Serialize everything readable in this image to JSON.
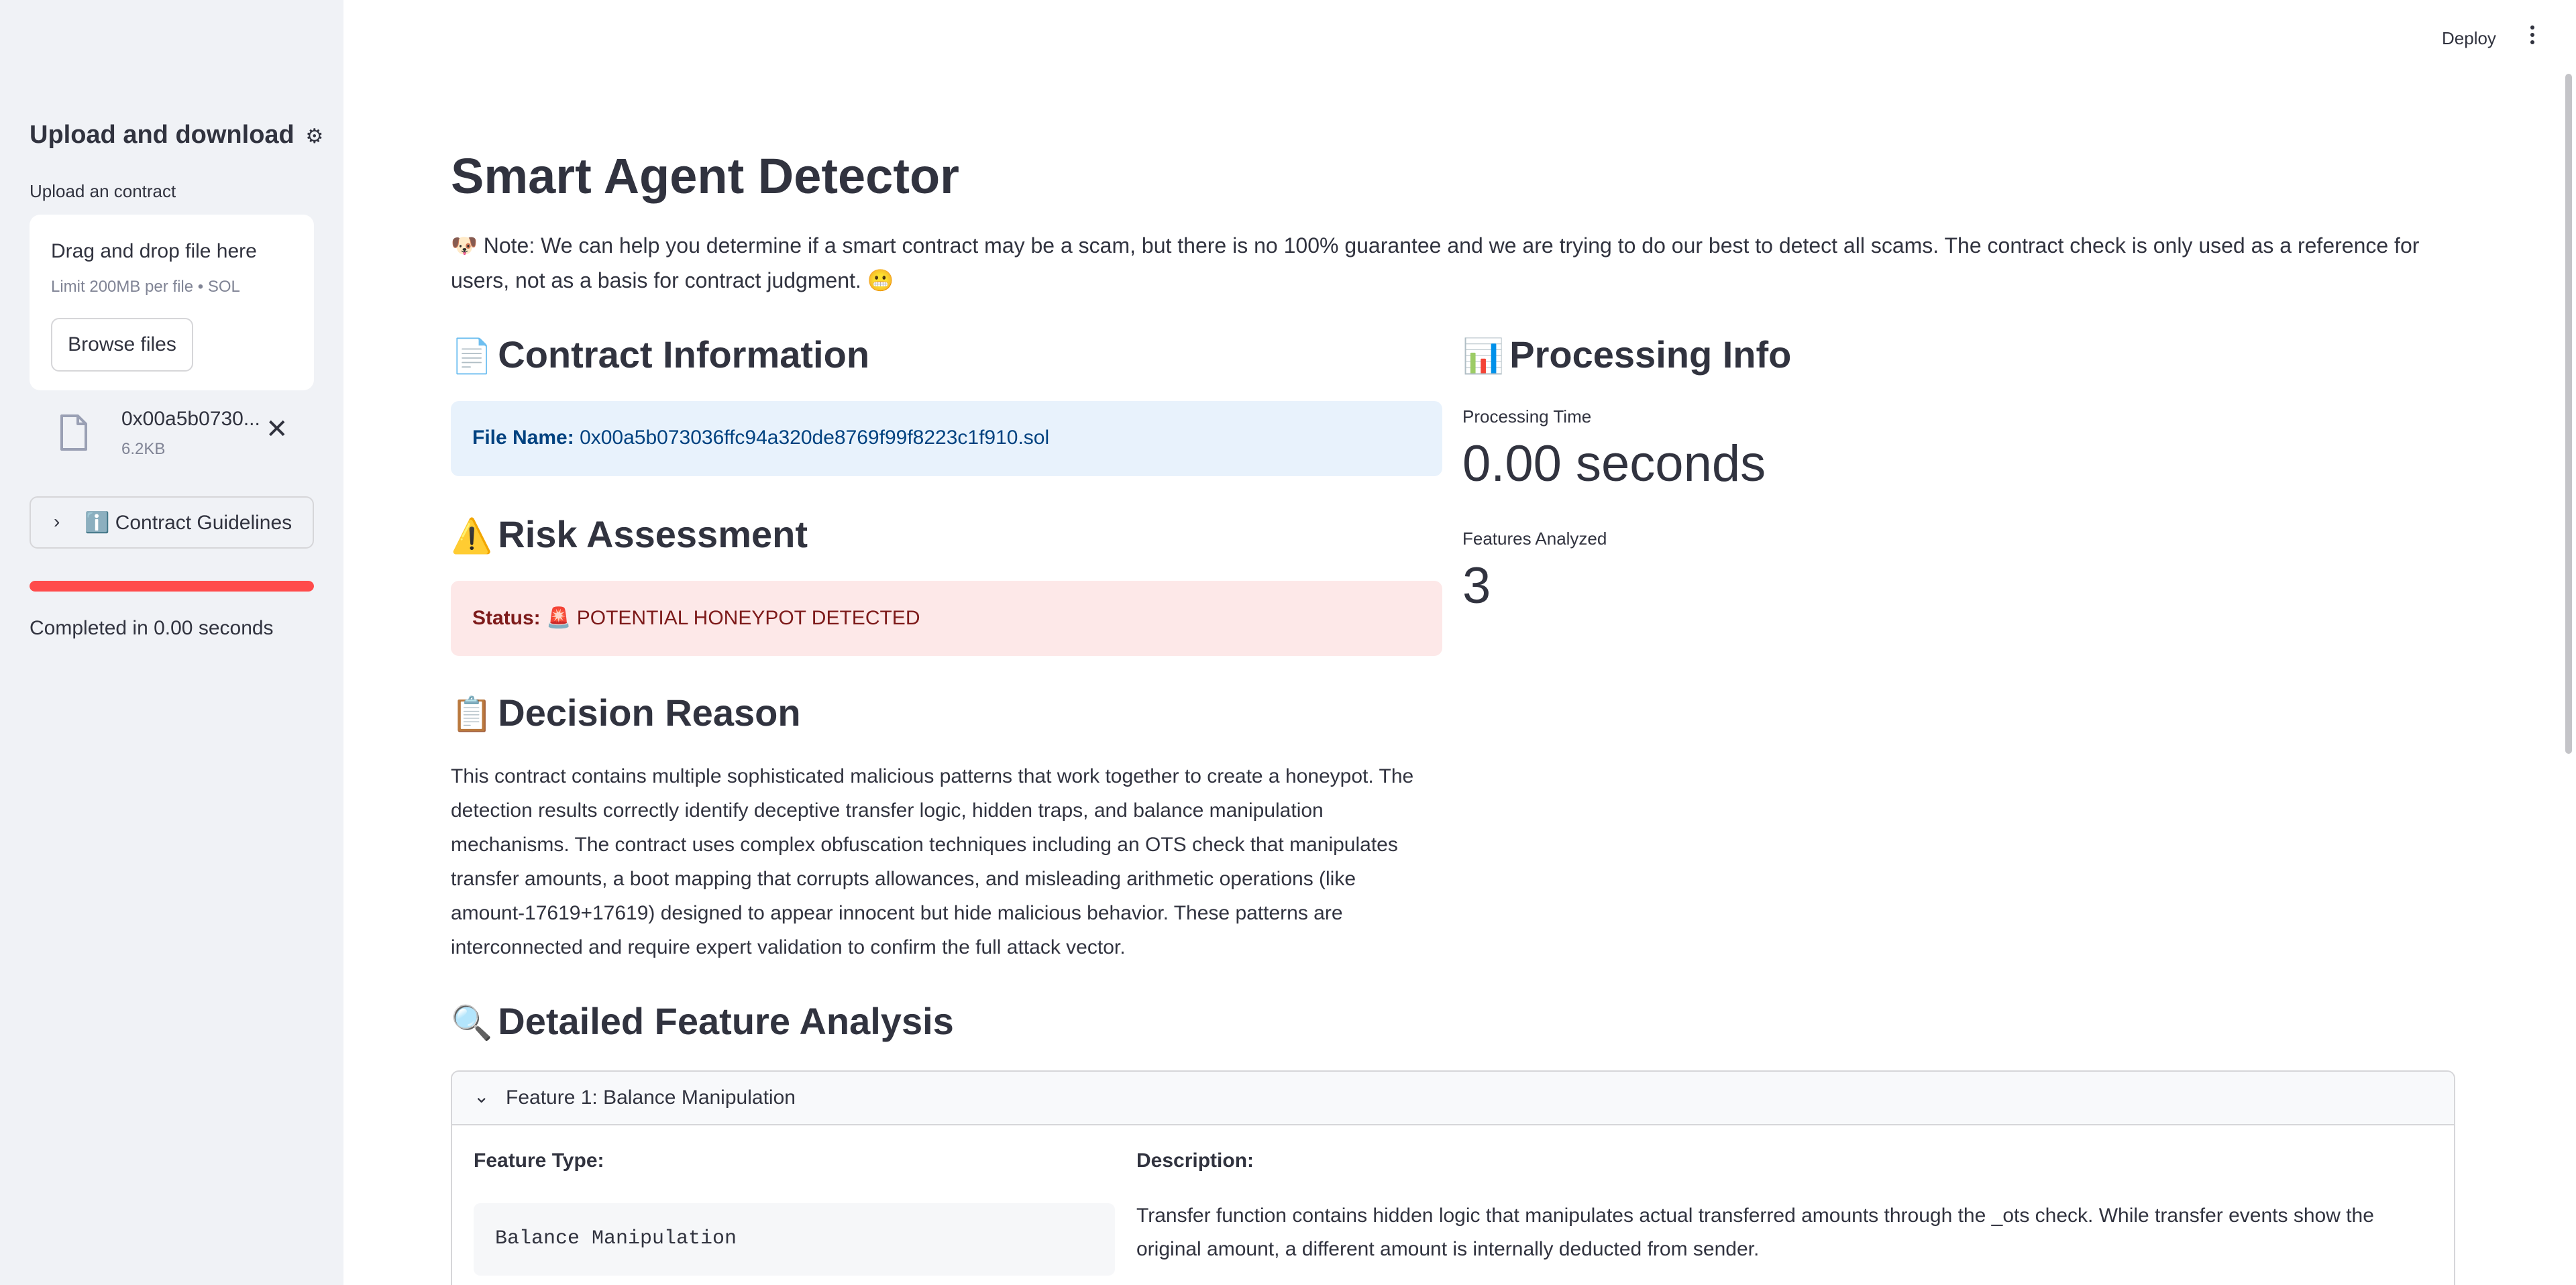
{
  "sidebar": {
    "title": "Upload and download",
    "title_icon": "⚙",
    "upload_label": "Upload an contract",
    "dropzone": {
      "title": "Drag and drop file here",
      "limit": "Limit 200MB per file • SOL",
      "browse_label": "Browse files"
    },
    "file": {
      "name": "0x00a5b0730...",
      "size": "6.2KB"
    },
    "guidelines": {
      "icon": "ℹ️",
      "label": "Contract Guidelines"
    },
    "progress_fraction": 1.0,
    "completed_text": "Completed in 0.00 seconds"
  },
  "header": {
    "deploy_label": "Deploy"
  },
  "main": {
    "title": "Smart Agent Detector",
    "note": {
      "icon": "🐶",
      "text": "Note: We can help you determine if a smart contract may be a scam, but there is no 100% guarantee and we are trying to do our best to detect all scams. The contract check is only used as a reference for users, not as a basis for contract judgment.",
      "end_icon": "😬"
    },
    "contract_info": {
      "icon": "📄",
      "heading": "Contract Information",
      "file_key": "File Name:",
      "file_value": "0x00a5b073036ffc94a320de8769f99f8223c1f910.sol"
    },
    "risk": {
      "icon": "⚠️",
      "heading": "Risk Assessment",
      "status_key": "Status:",
      "status_icon": "🚨",
      "status_value": "POTENTIAL HONEYPOT DETECTED"
    },
    "decision": {
      "icon": "📋",
      "heading": "Decision Reason",
      "text": "This contract contains multiple sophisticated malicious patterns that work together to create a honeypot. The detection results correctly identify deceptive transfer logic, hidden traps, and balance manipulation mechanisms. The contract uses complex obfuscation techniques including an OTS check that manipulates transfer amounts, a boot mapping that corrupts allowances, and misleading arithmetic operations (like amount-17619+17619) designed to appear innocent but hide malicious behavior. These patterns are interconnected and require expert validation to confirm the full attack vector."
    },
    "processing": {
      "icon": "📊",
      "heading": "Processing Info",
      "time_label": "Processing Time",
      "time_value": "0.00 seconds",
      "features_label": "Features Analyzed",
      "features_value": "3"
    },
    "features": {
      "icon": "🔍",
      "heading": "Detailed Feature Analysis",
      "items": [
        {
          "label": "Feature 1: Balance Manipulation",
          "type_label": "Feature Type:",
          "type_value": "Balance Manipulation",
          "desc_label": "Description:",
          "desc_value": "Transfer function contains hidden logic that manipulates actual transferred amounts through the _ots check. While transfer events show the original amount, a different amount is internally deducted from sender."
        }
      ]
    }
  },
  "colors": {
    "sidebar_bg": "#f0f2f6",
    "progress": "#ff4b4b",
    "info_bg": "#e8f2fc",
    "info_text": "#004280",
    "error_bg": "#fde8e8",
    "error_text": "#7d1a1a"
  }
}
